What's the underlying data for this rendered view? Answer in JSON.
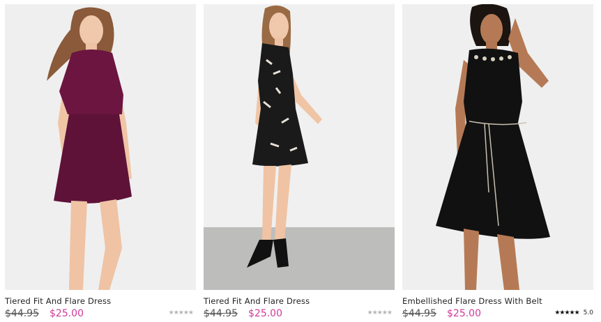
{
  "products": [
    {
      "title": "Tiered Fit And Flare Dress",
      "original_price": "$44.95",
      "sale_price": "$25.00",
      "stars": "★★★★★",
      "rating": "",
      "dress_color": "#6b1540"
    },
    {
      "title": "Tiered Fit And Flare Dress",
      "original_price": "$44.95",
      "sale_price": "$25.00",
      "stars": "★★★★★",
      "rating": "",
      "dress_color": "#1a1a1a"
    },
    {
      "title": "Embellished Flare Dress With Belt",
      "original_price": "$44.95",
      "sale_price": "$25.00",
      "stars": "★★★★★",
      "rating": "5.0",
      "dress_color": "#111111"
    }
  ],
  "colors": {
    "sale_price": "#d0399a",
    "background": "#ffffff"
  }
}
